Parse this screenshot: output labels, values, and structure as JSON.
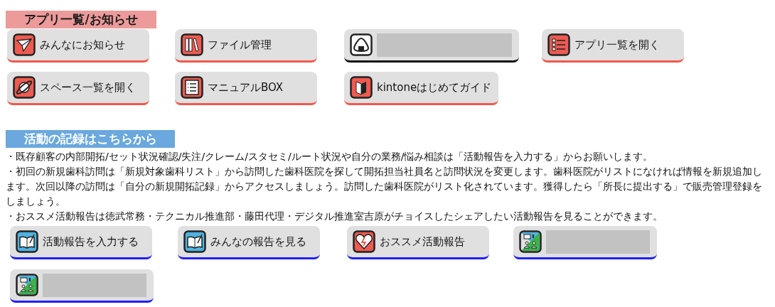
{
  "sections": [
    {
      "kind": "apps",
      "title": "アプリ一覧/お知らせ",
      "buttons": [
        {
          "kind": "app",
          "label": "みんなにお知らせ",
          "color": "#f0594c"
        },
        {
          "kind": "app",
          "label": "ファイル管理",
          "color": "#f0594c"
        },
        {
          "kind": "redacted",
          "color": "#111111"
        },
        {
          "kind": "app",
          "label": "アプリ一覧を開く",
          "color": "#f0594c"
        },
        {
          "kind": "app",
          "label": "スペース一覧を開く",
          "color": "#f0594c"
        },
        {
          "kind": "app",
          "label": "マニュアルBOX",
          "color": "#f0594c"
        },
        {
          "kind": "app",
          "label": "kintoneはじめてガイド",
          "color": "#f0594c"
        }
      ]
    },
    {
      "kind": "records",
      "title": "活動の記録はこちらから",
      "notes": [
        "・既存顧客の内部開拓/セット状況確認/失注/クレーム/スタセミ/ルート状況や自分の業務/悩み相談は「活動報告を入力する」からお願いします。",
        "・初回の新規歯科訪問は「新規対象歯科リスト」から訪問した歯科医院を探して開拓担当社員名と訪問状況を変更します。歯科医院がリストになければ情報を新規追加します。次回以降の訪問は「自分の新規開拓記録」からアクセスしましょう。訪問した歯科医院がリスト化されています。獲得したら「所長に提出する」で販売管理登録をしましょう。",
        "・おススメ活動報告は徳武常務・テクニカル推進部・藤田代理・デジタル推進室吉原がチョイスしたシェアしたい活動報告を見ることができます。"
      ],
      "buttons": [
        {
          "kind": "app",
          "label": "活動報告を入力する",
          "color": "#2020ff"
        },
        {
          "kind": "app",
          "label": "みんなの報告を見る",
          "color": "#2020ff"
        },
        {
          "kind": "app",
          "label": "おススメ活動報告",
          "color": "#2020ff"
        },
        {
          "kind": "redacted",
          "color": "#2020ff"
        },
        {
          "kind": "redacted",
          "color": "#2020ff"
        }
      ]
    }
  ]
}
